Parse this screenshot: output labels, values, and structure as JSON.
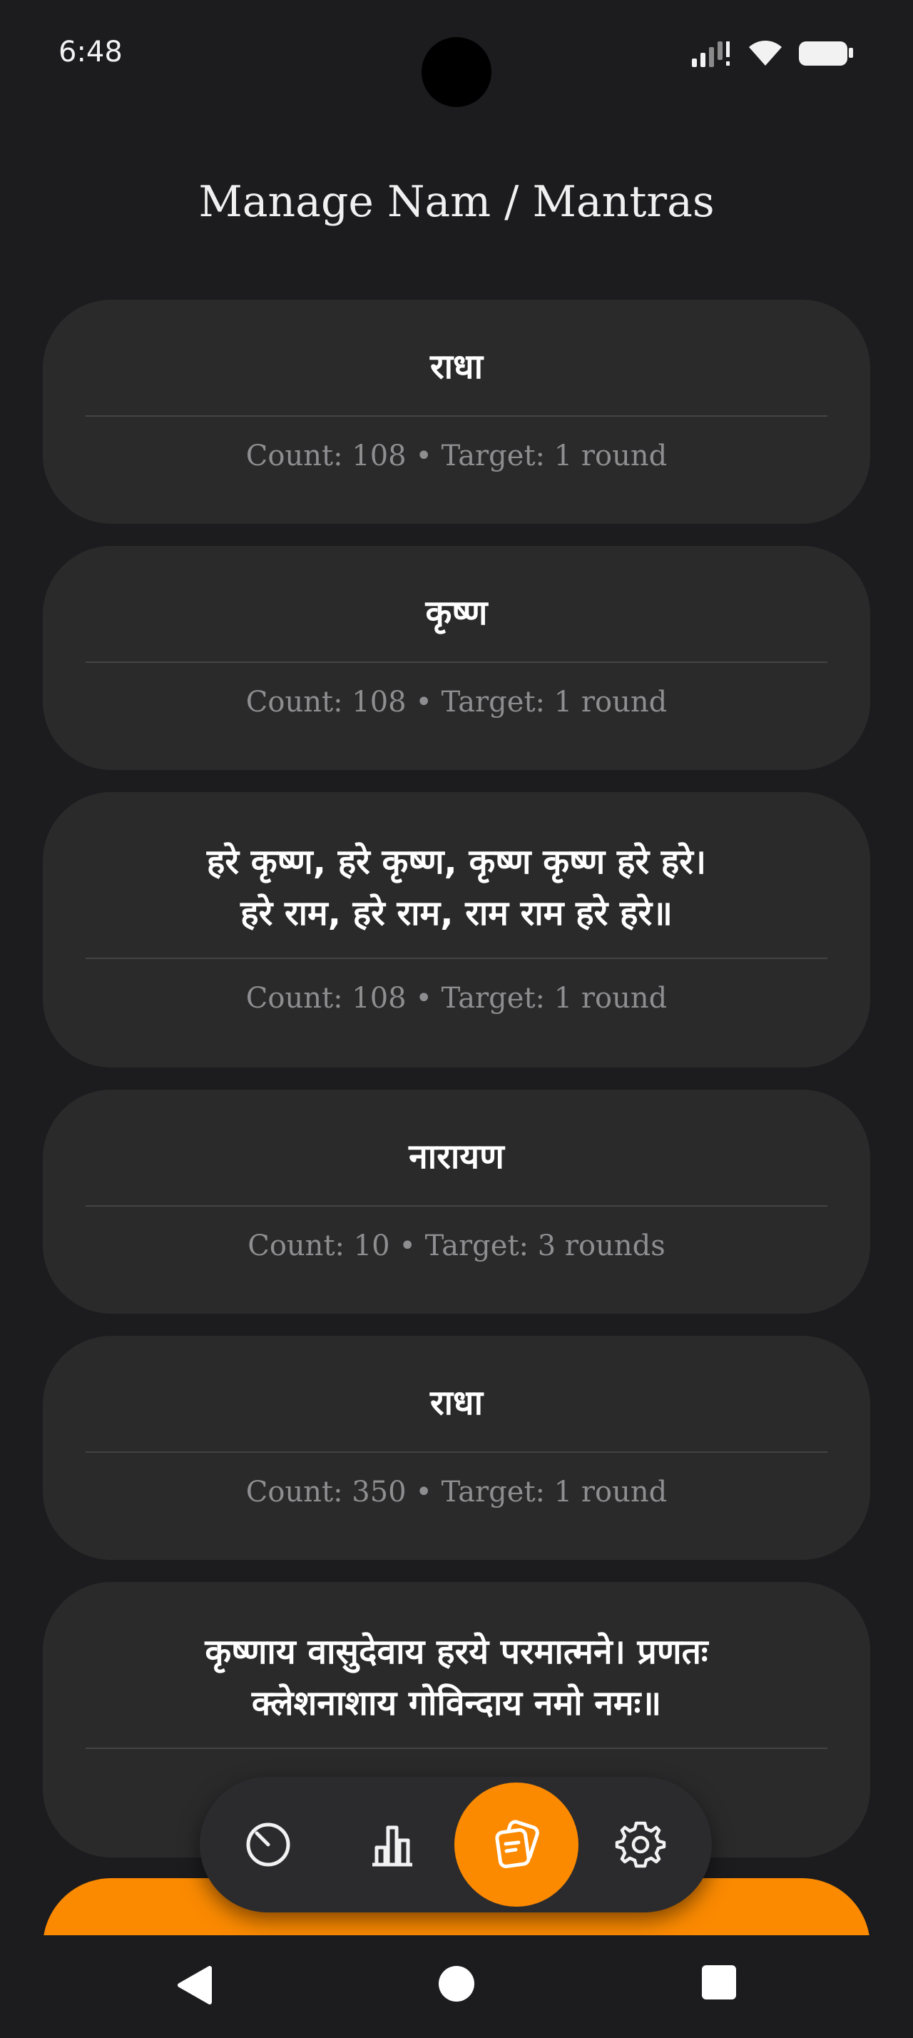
{
  "status_bar": {
    "time": "6:48",
    "icons": [
      "signal-icon",
      "wifi-icon",
      "battery-icon"
    ]
  },
  "header": {
    "title": "Manage Nam / Mantras"
  },
  "mantras": [
    {
      "name": "राधा",
      "meta": "Count: 108 • Target: 1 round"
    },
    {
      "name": "कृष्ण",
      "meta": "Count: 108 • Target: 1 round"
    },
    {
      "name": "हरे कृष्ण, हरे कृष्ण, कृष्ण कृष्ण हरे हरे।\nहरे राम, हरे राम, राम राम हरे हरे॥",
      "meta": "Count: 108 • Target: 1 round"
    },
    {
      "name": "नारायण",
      "meta": "Count: 10 • Target: 3 rounds"
    },
    {
      "name": "राधा",
      "meta": "Count: 350 • Target: 1 round"
    },
    {
      "name": "कृष्णाय वासुदेवाय हरये परमात्मने। प्रणतः\nक्लेशनाशाय गोविन्दाय नमो नमः॥",
      "meta": ""
    }
  ],
  "bottom_nav": {
    "items": [
      {
        "icon": "counter-dial-icon",
        "active": false
      },
      {
        "icon": "stats-bar-chart-icon",
        "active": false
      },
      {
        "icon": "mantras-cards-icon",
        "active": true
      },
      {
        "icon": "settings-gear-icon",
        "active": false
      }
    ]
  },
  "add_button": {
    "label": ""
  },
  "colors": {
    "accent": "#fb8a00",
    "background": "#1c1c1e",
    "card": "#2a2a2b",
    "meta_text": "#8e8e90"
  }
}
